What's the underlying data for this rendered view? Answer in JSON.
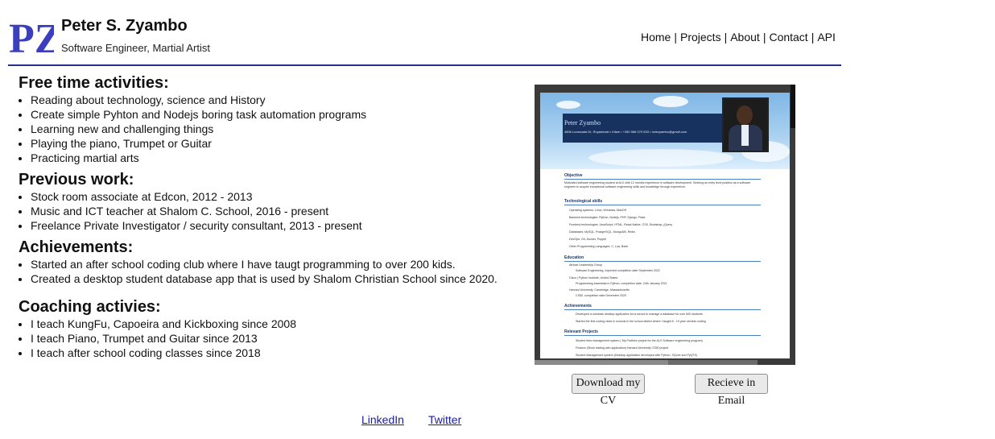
{
  "header": {
    "logo_text": "PZ",
    "name": "Peter S. Zyambo",
    "tagline": "Software Engineer, Martial Artist",
    "nav": [
      "Home",
      "Projects",
      "About",
      "Contact",
      "API"
    ],
    "nav_separator": "|"
  },
  "sections": [
    {
      "title": "Free time activities:",
      "items": [
        "Reading about technology, science and History",
        "Create simple Pyhton and Nodejs boring task automation programs",
        "Learning new and challenging things",
        "Playing the piano, Trumpet or Guitar",
        "Practicing martial arts"
      ]
    },
    {
      "title": "Previous work:",
      "items": [
        "Stock room associate at Edcon, 2012 - 2013",
        "Music and ICT teacher at Shalom C. School, 2016 - present",
        "Freelance Private Investigator / security consultant, 2013 - present"
      ]
    },
    {
      "title": "Achievements:",
      "items": [
        "Started an after school coding club where I have taugt programming to over 200 kids.",
        "Created a desktop student database app  that is used by Shalom Christian School since 2020."
      ]
    },
    {
      "title": "Coaching activies:",
      "items": [
        "I teach KungFu, Capoeira and Kickboxing since 2008",
        "I teach Piano, Trumpet and Guitar since 2013",
        "I teach after school coding classes since 2018"
      ]
    }
  ],
  "cv_preview": {
    "name": "Peter Zyambo",
    "contact": "4806 Lunzwada Dr, Ruyambaki  •  Kitwe  •  +260 966 070 533  •  riziezyambo@gmail.com",
    "objective_title": "Objective",
    "objective_text": "Motivated software engineering student at ALX with 12 months experience in software development. Seeking an entry level position as a software engineer to acquire exceptional software engineering skills and knowledge through experience.",
    "tech_title": "Technological skills",
    "tech_items": [
      "Operating systems: Linux, Windows, MacOS",
      "Backend technologies: Python, Nodejs, PHP, Django, Flask",
      "Frontend technologies: JavaScript, HTML, React Native, CSS, Bootstrap, jQuery",
      "Databases: MySQL, PostgreSQL, MongoDB, Redis",
      "DevOps: Git, Docker, Puppet",
      "Other Programming Languages: C, Lua, Bash"
    ],
    "education_title": "Education",
    "education_items": [
      "African Leadership Group",
      "Software Engineering, expected completion date September 2022",
      "Cisco | Python Institute, United States",
      "Programming essentials in Python, completion date: 24th January 2021",
      "Harvard University, Cambridge, Massachusetts",
      "CS50, completion date December 2020"
    ],
    "achievements_title": "Achievements",
    "achievements_items": [
      "Developed a windows desktop application for a school to manage a database for over 600 students",
      "Started the first coding clubs in schools in the school district where I taught 8 - 19 year old kids coding"
    ],
    "projects_title": "Relevant Projects",
    "projects_items": [
      "Student fees management system ( My Portfolio project for the ALX Software engineering program)",
      "Finance (Stock trading web application) Harvard University CS50 project",
      "Student Management system (Desktop application developed with Python, SQLite and PyQT5)"
    ],
    "side_char": "d"
  },
  "buttons": {
    "download": "Download my CV",
    "email": "Recieve in Email"
  },
  "footer": {
    "linkedin": "LinkedIn",
    "twitter": "Twitter"
  },
  "colors": {
    "accent_rule": "#2c2f8a",
    "logo": "#3b3fbf",
    "link": "#1a1aa6"
  }
}
